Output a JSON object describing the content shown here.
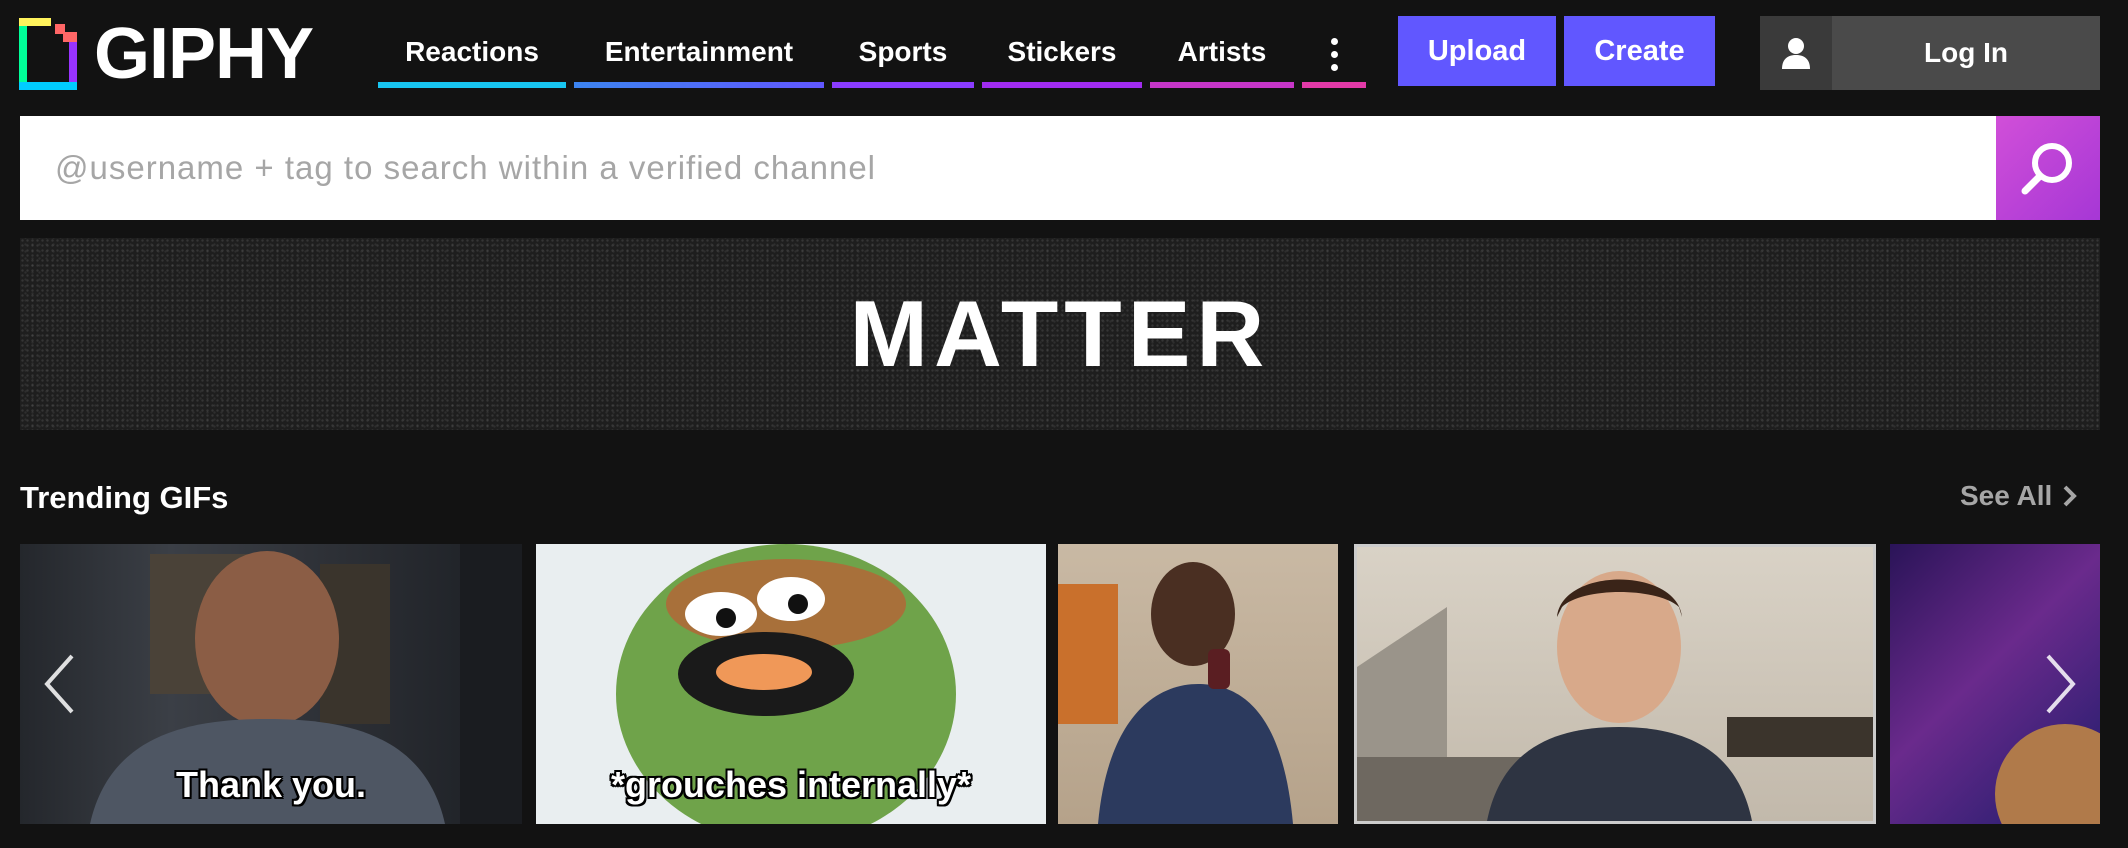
{
  "logo": {
    "text": "GIPHY"
  },
  "nav": {
    "items": [
      {
        "label": "Reactions",
        "color": "#18c5f0",
        "width": 188
      },
      {
        "label": "Entertainment",
        "color": "#6157ff",
        "width": 250
      },
      {
        "label": "Sports",
        "color": "#9933ff",
        "width": 142
      },
      {
        "label": "Stickers",
        "color": "#b02ce0",
        "width": 160
      },
      {
        "label": "Artists",
        "color": "#e33aa8",
        "width": 144
      }
    ],
    "more_color": "#e33aa8"
  },
  "actions": {
    "upload_label": "Upload",
    "create_label": "Create",
    "button_color": "#6157ff",
    "login_label": "Log In"
  },
  "search": {
    "placeholder": "@username + tag to search within a verified channel",
    "button_color": "#c643d4"
  },
  "banner": {
    "text": "MATTER"
  },
  "trending": {
    "title": "Trending GIFs",
    "see_all_label": "See All",
    "gifs": [
      {
        "caption": "Thank you."
      },
      {
        "caption": "*grouches internally*"
      },
      {
        "caption": ""
      },
      {
        "caption": ""
      },
      {
        "caption": ""
      }
    ]
  }
}
